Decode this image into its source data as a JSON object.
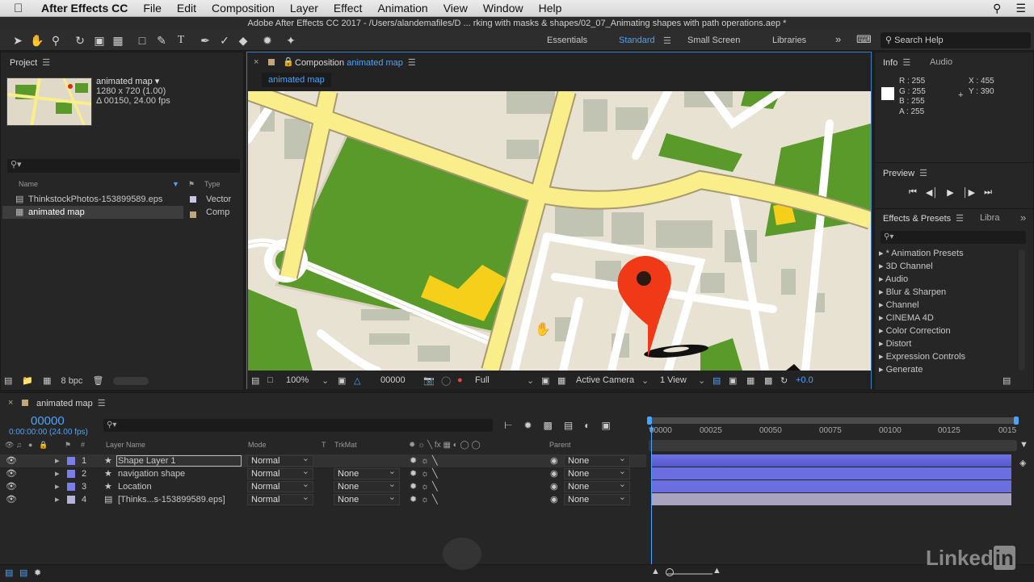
{
  "menubar": {
    "app": "After Effects CC",
    "items": [
      "File",
      "Edit",
      "Composition",
      "Layer",
      "Effect",
      "Animation",
      "View",
      "Window",
      "Help"
    ]
  },
  "window_title": "Adobe After Effects CC 2017 - /Users/alandemafiles/D ... rking with masks & shapes/02_07_Animating shapes with path operations.aep *",
  "workspaces": {
    "essentials": "Essentials",
    "standard": "Standard",
    "small_screen": "Small Screen",
    "libraries": "Libraries"
  },
  "search_help": "Search Help",
  "project": {
    "tab": "Project",
    "comp_name": "animated map ▾",
    "comp_size": "1280 x 720 (1.00)",
    "comp_duration": "Δ 00150, 24.00 fps",
    "col_name": "Name",
    "col_type": "Type",
    "items": [
      {
        "name": "ThinkstockPhotos-153899589.eps",
        "type": "Vector"
      },
      {
        "name": "animated map",
        "type": "Comp"
      }
    ],
    "bpc": "8 bpc"
  },
  "composition": {
    "tab_prefix": "Composition",
    "tab_name": "animated map",
    "subtab": "animated map",
    "footer": {
      "zoom": "100%",
      "timecode": "00000",
      "resolution": "Full",
      "camera": "Active Camera",
      "views": "1 View",
      "exposure": "+0.0"
    }
  },
  "info": {
    "tab": "Info",
    "tab2": "Audio",
    "r": "R : 255",
    "g": "G : 255",
    "b": "B : 255",
    "a": "A : 255",
    "x": "X : 455",
    "y": "Y : 390",
    "swatch": "#ffffff"
  },
  "preview": {
    "tab": "Preview"
  },
  "effects": {
    "tab": "Effects & Presets",
    "tab2": "Libra",
    "items": [
      "* Animation Presets",
      "3D Channel",
      "Audio",
      "Blur & Sharpen",
      "Channel",
      "CINEMA 4D",
      "Color Correction",
      "Distort",
      "Expression Controls",
      "Generate"
    ]
  },
  "timeline": {
    "tab": "animated map",
    "timecode": "00000",
    "timecode_sub": "0:00:00:00 (24.00 fps)",
    "headers": {
      "num": "#",
      "layer_name": "Layer Name",
      "mode": "Mode",
      "t": "T",
      "trkmat": "TrkMat",
      "parent": "Parent"
    },
    "ruler": [
      "00000",
      "00025",
      "00050",
      "00075",
      "00100",
      "00125",
      "0015"
    ],
    "layers": [
      {
        "num": "1",
        "name": "Shape Layer 1",
        "mode": "Normal",
        "trkmat": "",
        "parent": "None",
        "color": "#6a6ee0"
      },
      {
        "num": "2",
        "name": "navigation shape",
        "mode": "Normal",
        "trkmat": "None",
        "parent": "None",
        "color": "#6a6ee0"
      },
      {
        "num": "3",
        "name": "Location",
        "mode": "Normal",
        "trkmat": "None",
        "parent": "None",
        "color": "#6a6ee0"
      },
      {
        "num": "4",
        "name": "[Thinks...s-153899589.eps]",
        "mode": "Normal",
        "trkmat": "None",
        "parent": "None",
        "color": "#a9a3c2"
      }
    ]
  },
  "colors": {
    "accent": "#4aa3ff",
    "map_green": "#5a9a2a",
    "road_yellow": "#f9ee8a",
    "pin_red": "#f03a17"
  }
}
